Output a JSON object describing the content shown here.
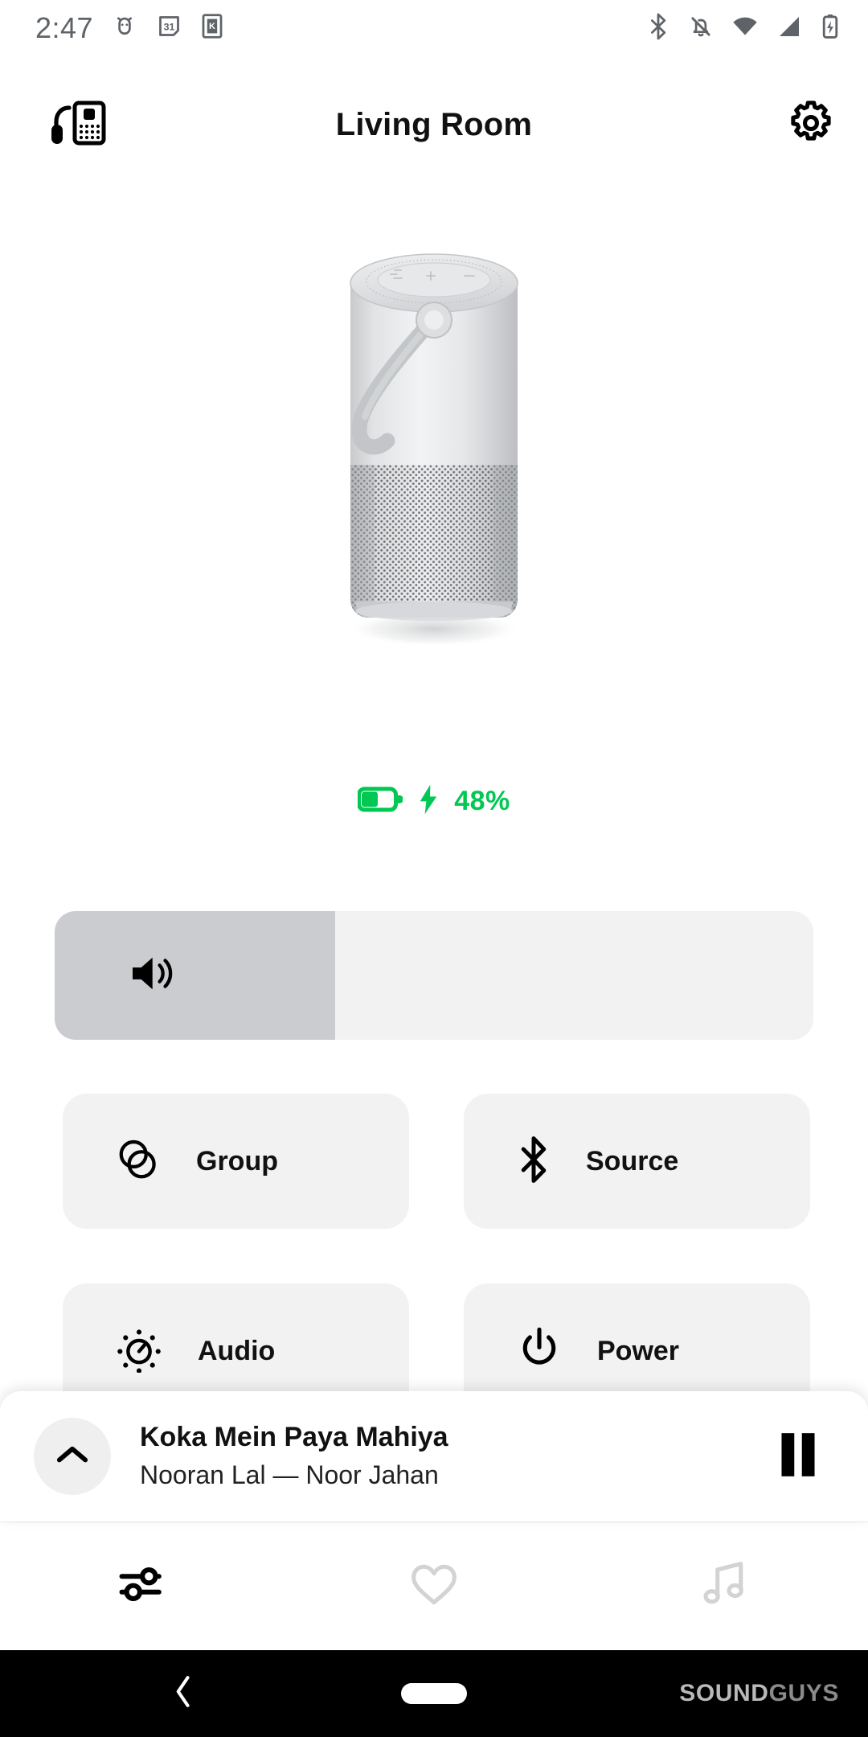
{
  "statusbar": {
    "clock": "2:47",
    "left_icons": [
      "android-alarm-icon",
      "calendar-31-icon",
      "k-app-icon"
    ],
    "right_icons": [
      "bluetooth-icon",
      "notifications-off-icon",
      "wifi-icon",
      "cellular-signal-icon",
      "battery-charging-icon"
    ],
    "icon_color": "#5f6368"
  },
  "header": {
    "left_icon": "my-devices-icon",
    "title": "Living Room",
    "right_icon": "gear-icon"
  },
  "device": {
    "image_name": "bose-portable-home-speaker-silver",
    "alt": "Silver portable cylindrical smart speaker with handle"
  },
  "battery": {
    "icon": "battery-icon",
    "charging_icon": "lightning-bolt-icon",
    "percent_label": "48%",
    "percent_value": 48,
    "color": "#00c853"
  },
  "volume": {
    "icon": "volume-up-icon",
    "level_percent": 37,
    "fill_color": "#cbcccf",
    "track_color": "#f2f2f2"
  },
  "tiles": [
    {
      "label": "Group",
      "icon": "group-circles-icon"
    },
    {
      "label": "Source",
      "icon": "bluetooth-icon"
    },
    {
      "label": "Audio",
      "icon": "audio-tuning-icon"
    },
    {
      "label": "Power",
      "icon": "power-icon"
    }
  ],
  "now_playing": {
    "expand_icon": "chevron-up-icon",
    "title": "Koka Mein Paya Mahiya",
    "subtitle": "Nooran Lal — Noor Jahan",
    "transport_icon": "pause-icon",
    "state": "playing"
  },
  "tabbar": {
    "items": [
      {
        "name": "tab-controls",
        "icon": "sliders-icon",
        "active": true,
        "color": "#000000"
      },
      {
        "name": "tab-favorites",
        "icon": "heart-icon",
        "active": false,
        "color": "#d3d3d3"
      },
      {
        "name": "tab-music",
        "icon": "music-note-icon",
        "active": false,
        "color": "#d3d3d3"
      }
    ]
  },
  "navbar": {
    "back_icon": "back-chevron-icon",
    "home_icon": "home-pill-icon",
    "watermark_a": "SOUND",
    "watermark_b": "GUYS"
  }
}
